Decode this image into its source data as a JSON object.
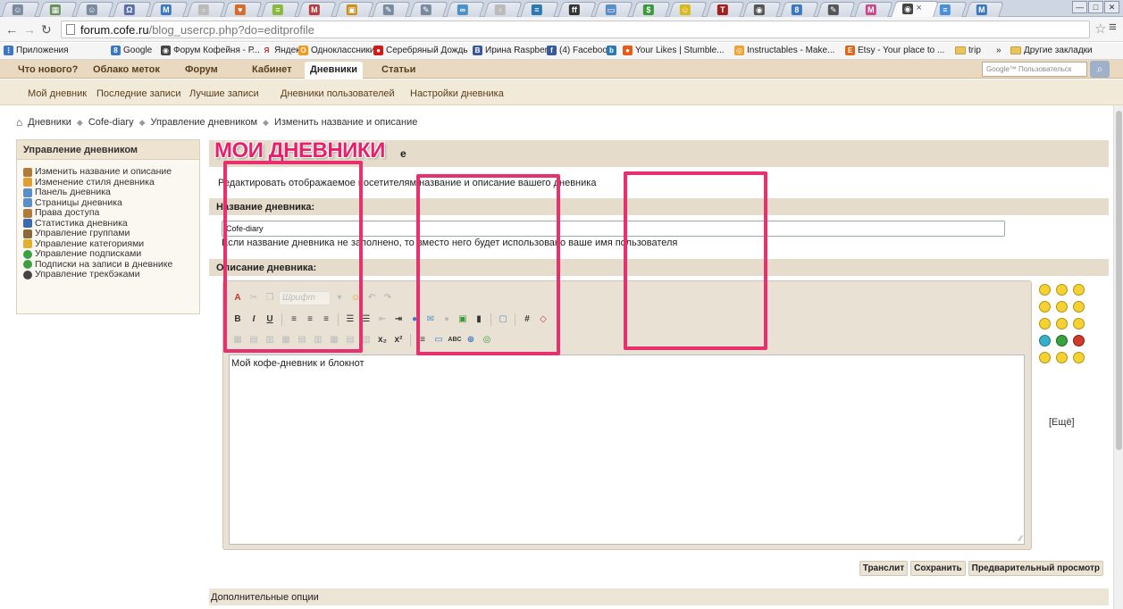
{
  "browser": {
    "tabs": [
      {
        "color": "#7a8aa0",
        "glyph": "☺"
      },
      {
        "color": "#6b8e5a",
        "glyph": "▦"
      },
      {
        "color": "#7a8aa0",
        "glyph": "☺"
      },
      {
        "color": "#5a6fb0",
        "glyph": "Ω"
      },
      {
        "color": "#3b78c4",
        "glyph": "M"
      },
      {
        "color": "#bbbbbb",
        "glyph": "▫"
      },
      {
        "color": "#d86a2a",
        "glyph": "♥"
      },
      {
        "color": "#8ab83a",
        "glyph": "≡"
      },
      {
        "color": "#b83a3a",
        "glyph": "M"
      },
      {
        "color": "#c8901a",
        "glyph": "▣"
      },
      {
        "color": "#7a8aa0",
        "glyph": "✎"
      },
      {
        "color": "#7a8aa0",
        "glyph": "✎"
      },
      {
        "color": "#4c90c8",
        "glyph": "∞"
      },
      {
        "color": "#bbbbbb",
        "glyph": "▫"
      },
      {
        "color": "#2a7ab0",
        "glyph": "≡"
      },
      {
        "color": "#333333",
        "glyph": "ff"
      },
      {
        "color": "#5a8ec8",
        "glyph": "▭"
      },
      {
        "color": "#3a9a3a",
        "glyph": "$"
      },
      {
        "color": "#d8b81a",
        "glyph": "☺"
      },
      {
        "color": "#a02020",
        "glyph": "T"
      },
      {
        "color": "#555555",
        "glyph": "◉"
      },
      {
        "color": "#3b78c4",
        "glyph": "8"
      },
      {
        "color": "#555555",
        "glyph": "✎"
      },
      {
        "color": "#c84a8a",
        "glyph": "M"
      },
      {
        "color": "#444444",
        "glyph": "◉"
      },
      {
        "color": "#4a90d8",
        "glyph": "≡"
      },
      {
        "color": "#3b78c4",
        "glyph": "M"
      }
    ],
    "active_tab_close": "×",
    "url_host": "forum.cofe.ru",
    "url_path": "/blog_usercp.php?do=editprofile",
    "window_buttons": [
      "—",
      "□",
      "✕"
    ],
    "bookmarks": [
      {
        "label": "Приложения",
        "color": "#3b78c4",
        "glyph": "⋮"
      },
      {
        "label": "Google",
        "color": "#3b78c4",
        "glyph": "8"
      },
      {
        "label": "Форум Кофейня - Р...",
        "color": "#444444",
        "glyph": "◉"
      },
      {
        "label": "Яндекс",
        "color": "#ffffff",
        "glyph": "Я"
      },
      {
        "label": "Одноклассники",
        "color": "#f39a1a",
        "glyph": "О"
      },
      {
        "label": "Серебряный Дождь",
        "color": "#d01a1a",
        "glyph": "●"
      },
      {
        "label": "Ирина Raspberry",
        "color": "#3b5998",
        "glyph": "В"
      },
      {
        "label": "(4) Facebook",
        "color": "#3b5998",
        "glyph": "f"
      },
      {
        "label": "",
        "color": "#2a7ab0",
        "glyph": "b"
      },
      {
        "label": "Your Likes | Stumble...",
        "color": "#e85a1a",
        "glyph": "●"
      },
      {
        "label": "Instructables - Make...",
        "color": "#f2a030",
        "glyph": "◎"
      },
      {
        "label": "Etsy - Your place to ...",
        "color": "#e0661a",
        "glyph": "E"
      },
      {
        "label": "trip",
        "color": "",
        "glyph": ""
      }
    ],
    "more_bookmarks": "»",
    "other_bookmarks": "Другие закладки"
  },
  "site": {
    "nav": [
      "Что нового?",
      "Облако меток",
      "Форум",
      "Кабинет",
      "Дневники",
      "Статьи"
    ],
    "active_nav": "Дневники",
    "search_placeholder": "Google™ Пользовательск",
    "subnav": [
      "Мой дневник",
      "Последние записи",
      "Лучшие записи",
      "Дневники пользователей",
      "Настройки дневника"
    ]
  },
  "breadcrumb": [
    "Дневники",
    "Cofe-diary",
    "Управление дневником",
    "Изменить название и описание"
  ],
  "sidebar": {
    "title": "Управление дневником",
    "items": [
      {
        "label": "Изменить название и описание",
        "color": "#b07a3a"
      },
      {
        "label": "Изменение стиля дневника",
        "color": "#e0a030"
      },
      {
        "label": "Панель дневника",
        "color": "#5a8ec8"
      },
      {
        "label": "Страницы дневника",
        "color": "#5a8ec8"
      },
      {
        "label": "Права доступа",
        "color": "#b07a3a"
      },
      {
        "label": "Статистика дневника",
        "color": "#3a6ab0"
      },
      {
        "label": "Управление группами",
        "color": "#8a6a3a"
      },
      {
        "label": "Управление категориями",
        "color": "#e0b030"
      },
      {
        "label": "Управление подписками",
        "color": "#3aa040"
      },
      {
        "label": "Подписки на записи в дневнике",
        "color": "#3aa040"
      },
      {
        "label": "Управление трекбэками",
        "color": "#444444"
      }
    ]
  },
  "main": {
    "overlay_title": "МОИ ДНЕВНИКИ",
    "header_suffix": "е",
    "description": "Редактировать отображаемое посетителям название и описание вашего дневника",
    "name_label": "Название дневника:",
    "name_value": "Cofe-diary",
    "name_hint": "Если название дневника не заполнено, то вместо него будет использовано ваше имя пользователя",
    "desc_label": "Описание дневника:",
    "editor_font": "Шрифт",
    "editor_content": "Мой кофе-дневник и блокнот",
    "more_smilies": "[Ещё]",
    "buttons": [
      "Транслит",
      "Сохранить",
      "Предварительный просмотр"
    ],
    "extra_options": "Дополнительные опции"
  },
  "colors": {
    "highlight": "#e8306e",
    "header_bg": "#e6dccb",
    "nav_bg": "#e8d9c0"
  }
}
